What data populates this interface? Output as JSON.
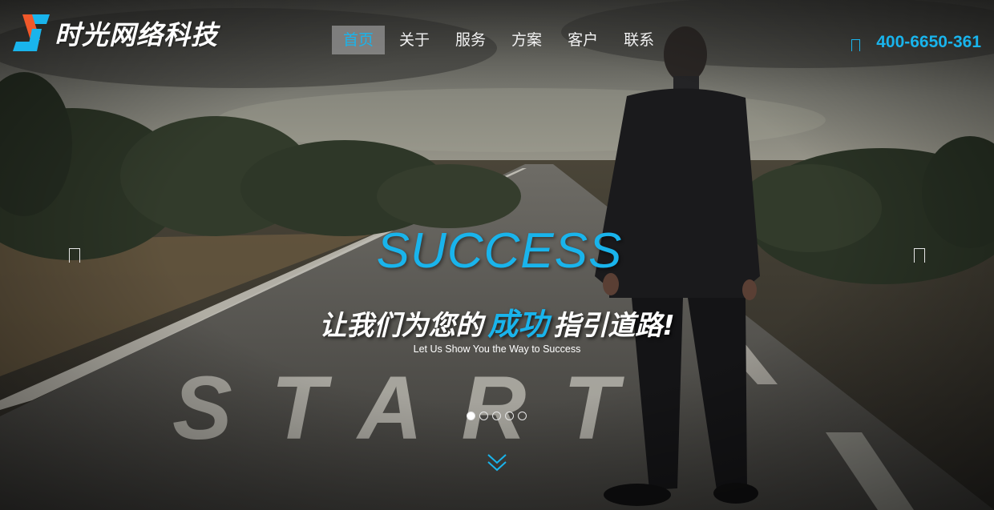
{
  "brand": {
    "name": "时光网络科技",
    "logo_icon": "s-logo-icon",
    "colors": {
      "accent": "#19b4ec",
      "logo_orange": "#f0582a"
    }
  },
  "nav": {
    "items": [
      {
        "label": "首页",
        "active": true
      },
      {
        "label": "关于",
        "active": false
      },
      {
        "label": "服务",
        "active": false
      },
      {
        "label": "方案",
        "active": false
      },
      {
        "label": "客户",
        "active": false
      },
      {
        "label": "联系",
        "active": false
      }
    ]
  },
  "contact": {
    "phone": "400-6650-361",
    "icon": "phone-icon"
  },
  "hero": {
    "headline_en": "SUCCESS",
    "headline_cn_prefix": "让我们为您的",
    "headline_cn_highlight": "成功",
    "headline_cn_suffix": "指引道路!",
    "subtitle": "Let Us Show You the Way to Success",
    "road_text": "START",
    "slides": {
      "count": 5,
      "active_index": 0
    },
    "prev_icon": "arrow-left-icon",
    "next_icon": "arrow-right-icon",
    "scroll_icon": "double-chevron-down-icon"
  }
}
